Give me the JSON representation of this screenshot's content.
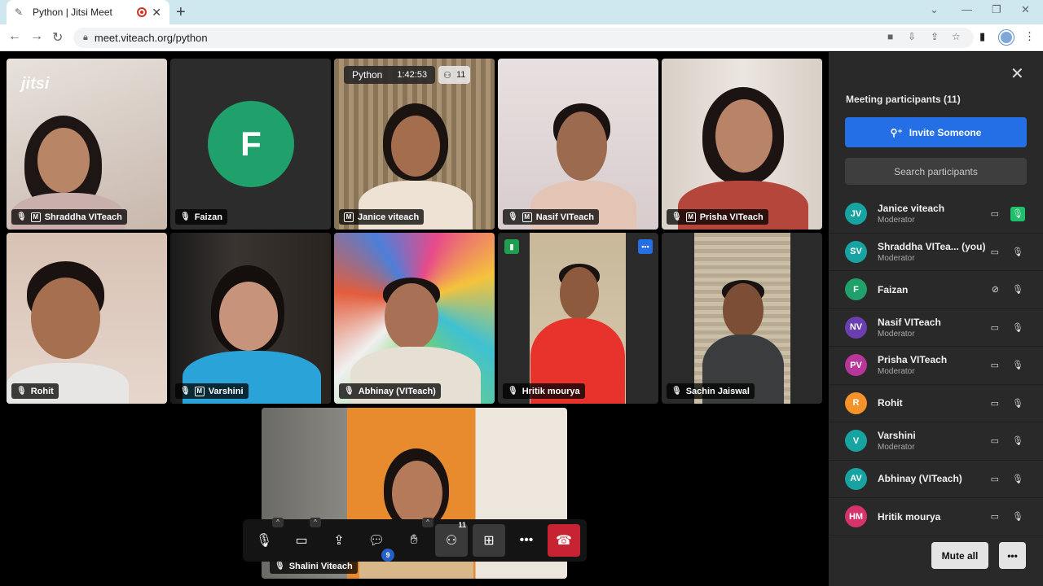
{
  "browser": {
    "tab_title": "Python | Jitsi Meet",
    "url": "meet.viteach.org/python",
    "new_tab": "+",
    "tab_close": "✕"
  },
  "meeting": {
    "room_name": "Python",
    "timer": "1:42:53",
    "participant_count": "11",
    "logo_text": "jitsi"
  },
  "tiles": [
    {
      "name": "Shraddha VITeach",
      "moderator": "M"
    },
    {
      "name": "Faizan",
      "avatar": "F"
    },
    {
      "name": "Janice viteach",
      "moderator": "M"
    },
    {
      "name": "Nasif VITeach",
      "moderator": "M"
    },
    {
      "name": "Prisha VITeach",
      "moderator": "M"
    },
    {
      "name": "Rohit"
    },
    {
      "name": "Varshini",
      "moderator": "M"
    },
    {
      "name": "Abhinay (VITeach)"
    },
    {
      "name": "Hritik mourya"
    },
    {
      "name": "Sachin Jaiswal"
    },
    {
      "name": "Shalini Viteach"
    }
  ],
  "toolbar": {
    "chat_badge": "9",
    "participants_count": "11"
  },
  "panel": {
    "title": "Meeting participants (11)",
    "invite_label": "Invite Someone",
    "search_placeholder": "Search participants",
    "mute_all": "Mute all",
    "more": "•••",
    "participants": [
      {
        "initials": "JV",
        "name": "Janice viteach",
        "role": "Moderator",
        "color": "#18a3a3"
      },
      {
        "initials": "SV",
        "name": "Shraddha VITea... (you)",
        "role": "Moderator",
        "color": "#18a3a3"
      },
      {
        "initials": "F",
        "name": "Faizan",
        "role": "",
        "color": "#20a06b"
      },
      {
        "initials": "NV",
        "name": "Nasif VITeach",
        "role": "Moderator",
        "color": "#6c3fb0"
      },
      {
        "initials": "PV",
        "name": "Prisha VITeach",
        "role": "Moderator",
        "color": "#b8359a"
      },
      {
        "initials": "R",
        "name": "Rohit",
        "role": "",
        "color": "#f5922a"
      },
      {
        "initials": "V",
        "name": "Varshini",
        "role": "Moderator",
        "color": "#18a3a3"
      },
      {
        "initials": "AV",
        "name": "Abhinay (VITeach)",
        "role": "",
        "color": "#18a3a3"
      },
      {
        "initials": "HM",
        "name": "Hritik mourya",
        "role": "",
        "color": "#d6336c"
      }
    ]
  },
  "colors": {
    "accent": "#246fe5",
    "hangup": "#c82333",
    "active_speaker": "#1ec06b"
  }
}
